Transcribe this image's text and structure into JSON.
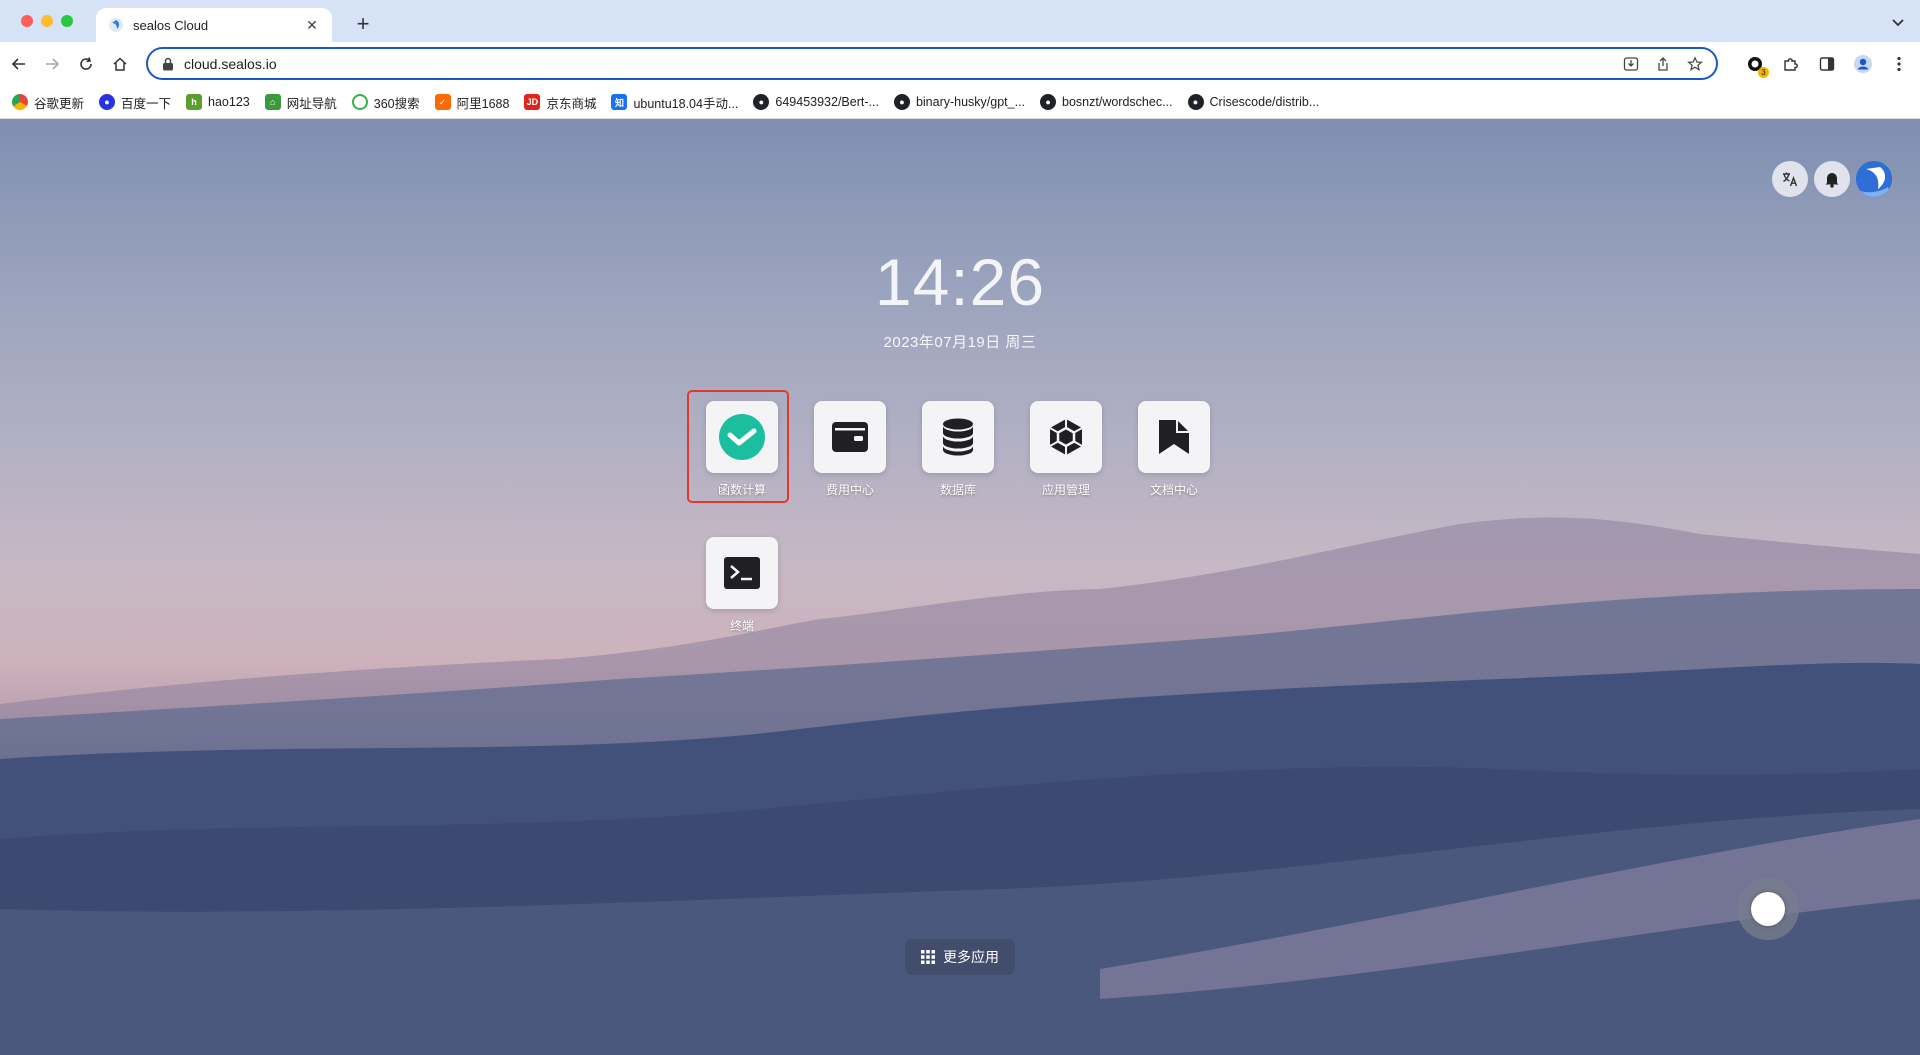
{
  "browser": {
    "tab_title": "sealos Cloud",
    "tab_close": "✕",
    "new_tab": "+",
    "url": "cloud.sealos.io",
    "extension_badge": "3"
  },
  "bookmarks": [
    {
      "label": "谷歌更新",
      "icon": "chrome-icon",
      "color": "#e8453c"
    },
    {
      "label": "百度一下",
      "icon": "baidu-icon",
      "color": "#2932e1"
    },
    {
      "label": "hao123",
      "icon": "hao123-icon",
      "color": "#5aa02c"
    },
    {
      "label": "网址导航",
      "icon": "2345-icon",
      "color": "#3a9b3a"
    },
    {
      "label": "360搜索",
      "icon": "360-icon",
      "color": "#36b24a"
    },
    {
      "label": "阿里1688",
      "icon": "1688-icon",
      "color": "#ff6a00"
    },
    {
      "label": "京东商城",
      "icon": "jd-icon",
      "color": "#e1251b"
    },
    {
      "label": "ubuntu18.04手动...",
      "icon": "zhihu-icon",
      "color": "#1772f6"
    },
    {
      "label": "649453932/Bert-...",
      "icon": "github-icon",
      "color": "#1f2328"
    },
    {
      "label": "binary-husky/gpt_...",
      "icon": "github-icon",
      "color": "#1f2328"
    },
    {
      "label": "bosnzt/wordschec...",
      "icon": "github-icon",
      "color": "#1f2328"
    },
    {
      "label": "Crisescode/distrib...",
      "icon": "github-icon",
      "color": "#1f2328"
    }
  ],
  "desktop": {
    "time": "14:26",
    "date": "2023年07月19日 周三",
    "apps": [
      {
        "label": "函数计算"
      },
      {
        "label": "费用中心"
      },
      {
        "label": "数据库"
      },
      {
        "label": "应用管理"
      },
      {
        "label": "文档中心"
      },
      {
        "label": "终端"
      }
    ],
    "more_apps": "更多应用"
  },
  "colors": {
    "accent": "#1a57c7",
    "highlight": "#e0392a",
    "laf_green": "#1bbf9f"
  }
}
